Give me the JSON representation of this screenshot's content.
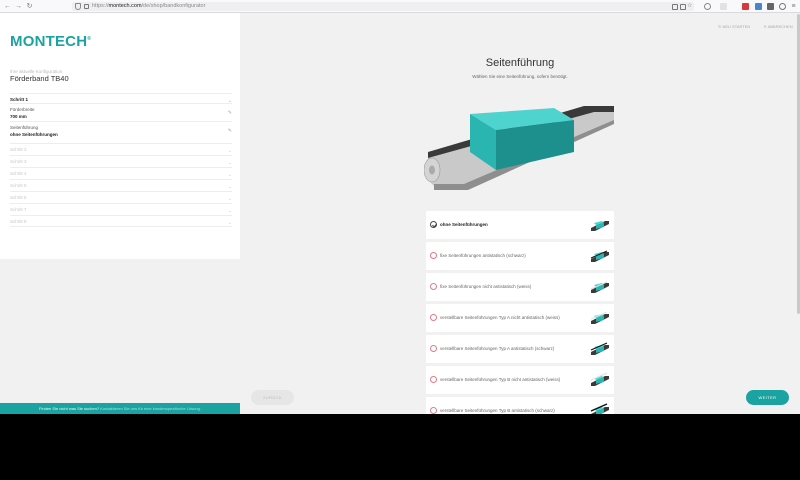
{
  "browser": {
    "url_prefix": "https://",
    "url_domain": "montech.com",
    "url_path": "/de/shop/bandkonfigurator"
  },
  "sidebar": {
    "logo": "MONTECH",
    "logo_mark": "®",
    "product_subtitle": "Ihre aktuelle Konfiguration",
    "product_title": "Förderband TB40",
    "steps": [
      {
        "label": "Schritt 1",
        "value": "",
        "state": "active",
        "icon": "chevron-down-icon"
      },
      {
        "label": "Förderbreite",
        "value": "700 mm",
        "state": "done",
        "icon": "pencil-icon"
      },
      {
        "label": "Seitenführung",
        "value": "ohne Seitenführungen",
        "state": "done",
        "icon": "pencil-icon"
      },
      {
        "label": "Schritt 2",
        "value": "",
        "state": "disabled",
        "icon": "chevron-down-icon"
      },
      {
        "label": "Schritt 3",
        "value": "",
        "state": "disabled",
        "icon": "chevron-down-icon"
      },
      {
        "label": "Schritt 4",
        "value": "",
        "state": "disabled",
        "icon": "chevron-down-icon"
      },
      {
        "label": "Schritt 5",
        "value": "",
        "state": "disabled",
        "icon": "chevron-down-icon"
      },
      {
        "label": "Schritt 6",
        "value": "",
        "state": "disabled",
        "icon": "chevron-down-icon"
      },
      {
        "label": "Schritt 7",
        "value": "",
        "state": "disabled",
        "icon": "chevron-down-icon"
      },
      {
        "label": "Schritt 8",
        "value": "",
        "state": "disabled",
        "icon": "chevron-down-icon"
      }
    ],
    "footer_text": "Finden Sie nicht was Sie suchen?",
    "footer_link": "Kontaktieren Sie uns für eine kundenspezifische Lösung."
  },
  "header": {
    "restart": "NEU STARTEN",
    "cancel": "ABBRECHEN"
  },
  "main": {
    "title": "Seitenführung",
    "subtitle": "Wählen Sie eine Seitenführung, sofern benötigt.",
    "options": [
      {
        "label": "ohne Seitenführungen",
        "selected": true
      },
      {
        "label": "fixe Seitenführungen antistatisch (schwarz)",
        "selected": false
      },
      {
        "label": "fixe Seitenführungen nicht antistatisch (weiss)",
        "selected": false
      },
      {
        "label": "verstellbare Seitenführungen Typ A nicht antistatisch (weiss)",
        "selected": false
      },
      {
        "label": "verstellbare Seitenführungen Typ A antistatisch (schwarz)",
        "selected": false
      },
      {
        "label": "verstellbare Seitenführungen Typ B nicht antistatisch (weiss)",
        "selected": false
      },
      {
        "label": "verstellbare Seitenführungen Typ B antistatisch (schwarz)",
        "selected": false
      }
    ],
    "back_label": "ZURÜCK",
    "next_label": "WEITER"
  },
  "colors": {
    "brand": "#1aa3a0",
    "box_top": "#4fd3cf",
    "box_front": "#2bb5b1",
    "box_side": "#1d8f8c",
    "belt": "#3a3a3a",
    "frame": "#c8c8c8",
    "radio_unselected": "#e07a86"
  }
}
